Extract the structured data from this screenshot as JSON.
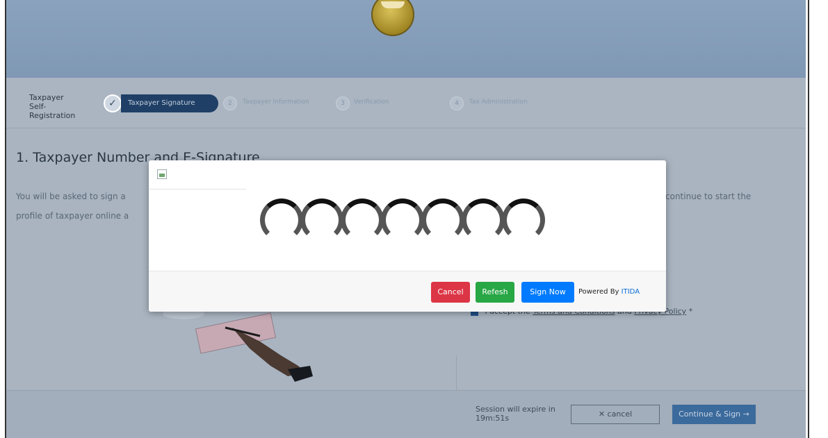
{
  "header": {
    "logo_icon": "emblem-logo-icon"
  },
  "stepper": {
    "label_line1": "Taxpayer",
    "label_line2": "Self-Registration",
    "steps": [
      {
        "num": "",
        "label": "Taxpayer Signature",
        "state": "completed-active"
      },
      {
        "num": "2",
        "label": "Taxpayer Information",
        "state": "pending"
      },
      {
        "num": "3",
        "label": "Verification",
        "state": "pending"
      },
      {
        "num": "4",
        "label": "Tax Administration",
        "state": "pending"
      }
    ]
  },
  "section": {
    "title": "1. Taxpayer Number and E-Signature",
    "description_left": "You will be asked to sign a",
    "description_left2": "profile of taxpayer online a",
    "description_right": "continue to start the",
    "consent_prefix": "I accept the",
    "consent_link1": "Terms and Conditions",
    "consent_mid": "and",
    "consent_link2": "Privacy Policy",
    "consent_suffix": "*"
  },
  "footer": {
    "session_line1": "Session will expire in",
    "session_line2": "19m:51s",
    "cancel_label": "cancel",
    "continue_label": "Continue & Sign"
  },
  "modal": {
    "cancel_label": "Cancel",
    "refresh_label": "Refesh",
    "sign_label": "Sign Now",
    "powered_prefix": "Powered By",
    "powered_brand": "ITIDA"
  },
  "colors": {
    "cancel": "#dc3545",
    "refresh": "#28a745",
    "sign": "#007bff",
    "brand_link": "#0a6cd6",
    "stepper_active": "#1f3f66"
  }
}
